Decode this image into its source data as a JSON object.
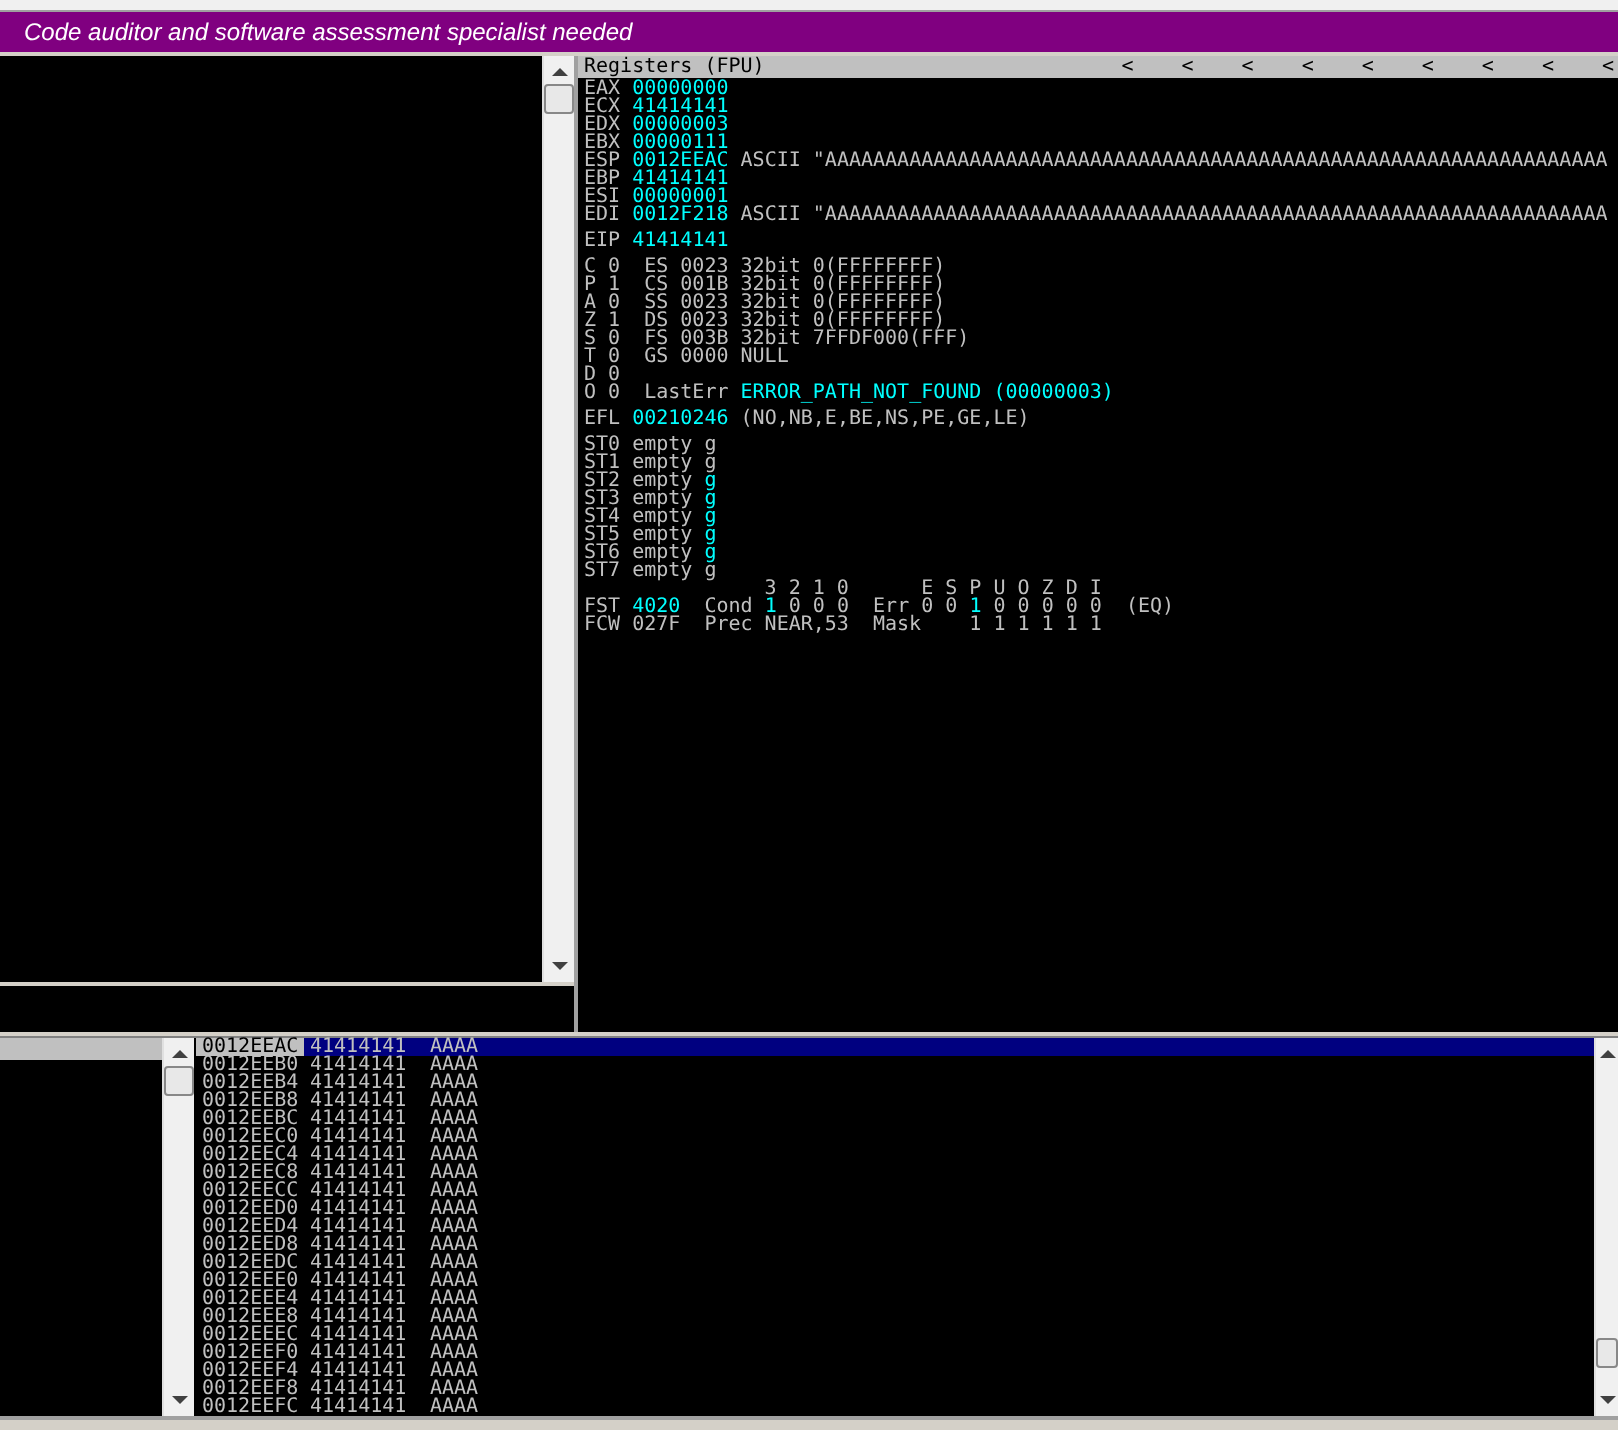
{
  "banner": {
    "text": "Code auditor and software assessment specialist needed"
  },
  "registers": {
    "title": "Registers (FPU)",
    "header_arrows": [
      "<",
      "<",
      "<",
      "<",
      "<",
      "<",
      "<",
      "<",
      "<"
    ],
    "groups": [
      {
        "lines": [
          {
            "segments": [
              {
                "text": "EAX ",
                "changed": false
              },
              {
                "text": "00000000",
                "changed": true
              }
            ]
          },
          {
            "segments": [
              {
                "text": "ECX ",
                "changed": false
              },
              {
                "text": "41414141",
                "changed": true
              }
            ]
          },
          {
            "segments": [
              {
                "text": "EDX ",
                "changed": false
              },
              {
                "text": "00000003",
                "changed": true
              }
            ]
          },
          {
            "segments": [
              {
                "text": "EBX ",
                "changed": false
              },
              {
                "text": "00000111",
                "changed": true
              }
            ]
          },
          {
            "segments": [
              {
                "text": "ESP ",
                "changed": false
              },
              {
                "text": "0012EEAC",
                "changed": true
              },
              {
                "text": " ASCII \"AAAAAAAAAAAAAAAAAAAAAAAAAAAAAAAAAAAAAAAAAAAAAAAAAAAAAAAAAAAAAAAAA",
                "changed": false
              }
            ]
          },
          {
            "segments": [
              {
                "text": "EBP ",
                "changed": false
              },
              {
                "text": "41414141",
                "changed": true
              }
            ]
          },
          {
            "segments": [
              {
                "text": "ESI ",
                "changed": false
              },
              {
                "text": "00000001",
                "changed": true
              }
            ]
          },
          {
            "segments": [
              {
                "text": "EDI ",
                "changed": false
              },
              {
                "text": "0012F218",
                "changed": true
              },
              {
                "text": " ASCII \"AAAAAAAAAAAAAAAAAAAAAAAAAAAAAAAAAAAAAAAAAAAAAAAAAAAAAAAAAAAAAAAAA",
                "changed": false
              }
            ]
          }
        ]
      },
      {
        "lines": [
          {
            "segments": [
              {
                "text": "EIP ",
                "changed": false
              },
              {
                "text": "41414141",
                "changed": true
              }
            ]
          }
        ]
      },
      {
        "lines": [
          {
            "segments": [
              {
                "text": "C 0  ES 0023 32bit 0(FFFFFFFF)",
                "changed": false
              }
            ]
          },
          {
            "segments": [
              {
                "text": "P 1  CS 001B 32bit 0(FFFFFFFF)",
                "changed": false
              }
            ]
          },
          {
            "segments": [
              {
                "text": "A 0  SS 0023 32bit 0(FFFFFFFF)",
                "changed": false
              }
            ]
          },
          {
            "segments": [
              {
                "text": "Z 1  DS 0023 32bit 0(FFFFFFFF)",
                "changed": false
              }
            ]
          },
          {
            "segments": [
              {
                "text": "S 0  FS 003B 32bit 7FFDF000(FFF)",
                "changed": false
              }
            ]
          },
          {
            "segments": [
              {
                "text": "T 0  GS 0000 NULL",
                "changed": false
              }
            ]
          },
          {
            "segments": [
              {
                "text": "D 0",
                "changed": false
              }
            ]
          },
          {
            "segments": [
              {
                "text": "O 0  LastErr ",
                "changed": false
              },
              {
                "text": "ERROR_PATH_NOT_FOUND (00000003)",
                "changed": true
              }
            ]
          }
        ]
      },
      {
        "lines": [
          {
            "segments": [
              {
                "text": "EFL ",
                "changed": false
              },
              {
                "text": "00210246",
                "changed": true
              },
              {
                "text": " (NO,NB,E,BE,NS,PE,GE,LE)",
                "changed": false
              }
            ]
          }
        ]
      },
      {
        "lines": [
          {
            "segments": [
              {
                "text": "ST0 empty ",
                "changed": false
              },
              {
                "text": "g",
                "changed": false
              }
            ]
          },
          {
            "segments": [
              {
                "text": "ST1 empty ",
                "changed": false
              },
              {
                "text": "g",
                "changed": false
              }
            ]
          },
          {
            "segments": [
              {
                "text": "ST2 empty ",
                "changed": false
              },
              {
                "text": "g",
                "changed": true
              }
            ]
          },
          {
            "segments": [
              {
                "text": "ST3 empty ",
                "changed": false
              },
              {
                "text": "g",
                "changed": true
              }
            ]
          },
          {
            "segments": [
              {
                "text": "ST4 empty ",
                "changed": false
              },
              {
                "text": "g",
                "changed": true
              }
            ]
          },
          {
            "segments": [
              {
                "text": "ST5 empty ",
                "changed": false
              },
              {
                "text": "g",
                "changed": true
              }
            ]
          },
          {
            "segments": [
              {
                "text": "ST6 empty ",
                "changed": false
              },
              {
                "text": "g",
                "changed": true
              }
            ]
          },
          {
            "segments": [
              {
                "text": "ST7 empty ",
                "changed": false
              },
              {
                "text": "g",
                "changed": false
              }
            ]
          },
          {
            "segments": [
              {
                "text": "               3 2 1 0      E S P U O Z D I",
                "changed": false
              }
            ]
          },
          {
            "segments": [
              {
                "text": "FST ",
                "changed": false
              },
              {
                "text": "4020",
                "changed": true
              },
              {
                "text": "  Cond ",
                "changed": false
              },
              {
                "text": "1",
                "changed": true
              },
              {
                "text": " 0 0 0  Err 0 0 ",
                "changed": false
              },
              {
                "text": "1",
                "changed": true
              },
              {
                "text": " 0 0 0 0 0  (EQ)",
                "changed": false
              }
            ]
          },
          {
            "segments": [
              {
                "text": "FCW 027F  Prec NEAR,53  Mask    1 1 1 1 1 1",
                "changed": false
              }
            ]
          }
        ]
      }
    ]
  },
  "stack": {
    "rows": [
      {
        "address": "0012EEAC",
        "value": "41414141",
        "ascii": "AAAA",
        "selected": true
      },
      {
        "address": "0012EEB0",
        "value": "41414141",
        "ascii": "AAAA",
        "selected": false
      },
      {
        "address": "0012EEB4",
        "value": "41414141",
        "ascii": "AAAA",
        "selected": false
      },
      {
        "address": "0012EEB8",
        "value": "41414141",
        "ascii": "AAAA",
        "selected": false
      },
      {
        "address": "0012EEBC",
        "value": "41414141",
        "ascii": "AAAA",
        "selected": false
      },
      {
        "address": "0012EEC0",
        "value": "41414141",
        "ascii": "AAAA",
        "selected": false
      },
      {
        "address": "0012EEC4",
        "value": "41414141",
        "ascii": "AAAA",
        "selected": false
      },
      {
        "address": "0012EEC8",
        "value": "41414141",
        "ascii": "AAAA",
        "selected": false
      },
      {
        "address": "0012EECC",
        "value": "41414141",
        "ascii": "AAAA",
        "selected": false
      },
      {
        "address": "0012EED0",
        "value": "41414141",
        "ascii": "AAAA",
        "selected": false
      },
      {
        "address": "0012EED4",
        "value": "41414141",
        "ascii": "AAAA",
        "selected": false
      },
      {
        "address": "0012EED8",
        "value": "41414141",
        "ascii": "AAAA",
        "selected": false
      },
      {
        "address": "0012EEDC",
        "value": "41414141",
        "ascii": "AAAA",
        "selected": false
      },
      {
        "address": "0012EEE0",
        "value": "41414141",
        "ascii": "AAAA",
        "selected": false
      },
      {
        "address": "0012EEE4",
        "value": "41414141",
        "ascii": "AAAA",
        "selected": false
      },
      {
        "address": "0012EEE8",
        "value": "41414141",
        "ascii": "AAAA",
        "selected": false
      },
      {
        "address": "0012EEEC",
        "value": "41414141",
        "ascii": "AAAA",
        "selected": false
      },
      {
        "address": "0012EEF0",
        "value": "41414141",
        "ascii": "AAAA",
        "selected": false
      },
      {
        "address": "0012EEF4",
        "value": "41414141",
        "ascii": "AAAA",
        "selected": false
      },
      {
        "address": "0012EEF8",
        "value": "41414141",
        "ascii": "AAAA",
        "selected": false
      },
      {
        "address": "0012EEFC",
        "value": "41414141",
        "ascii": "AAAA",
        "selected": false
      }
    ]
  }
}
